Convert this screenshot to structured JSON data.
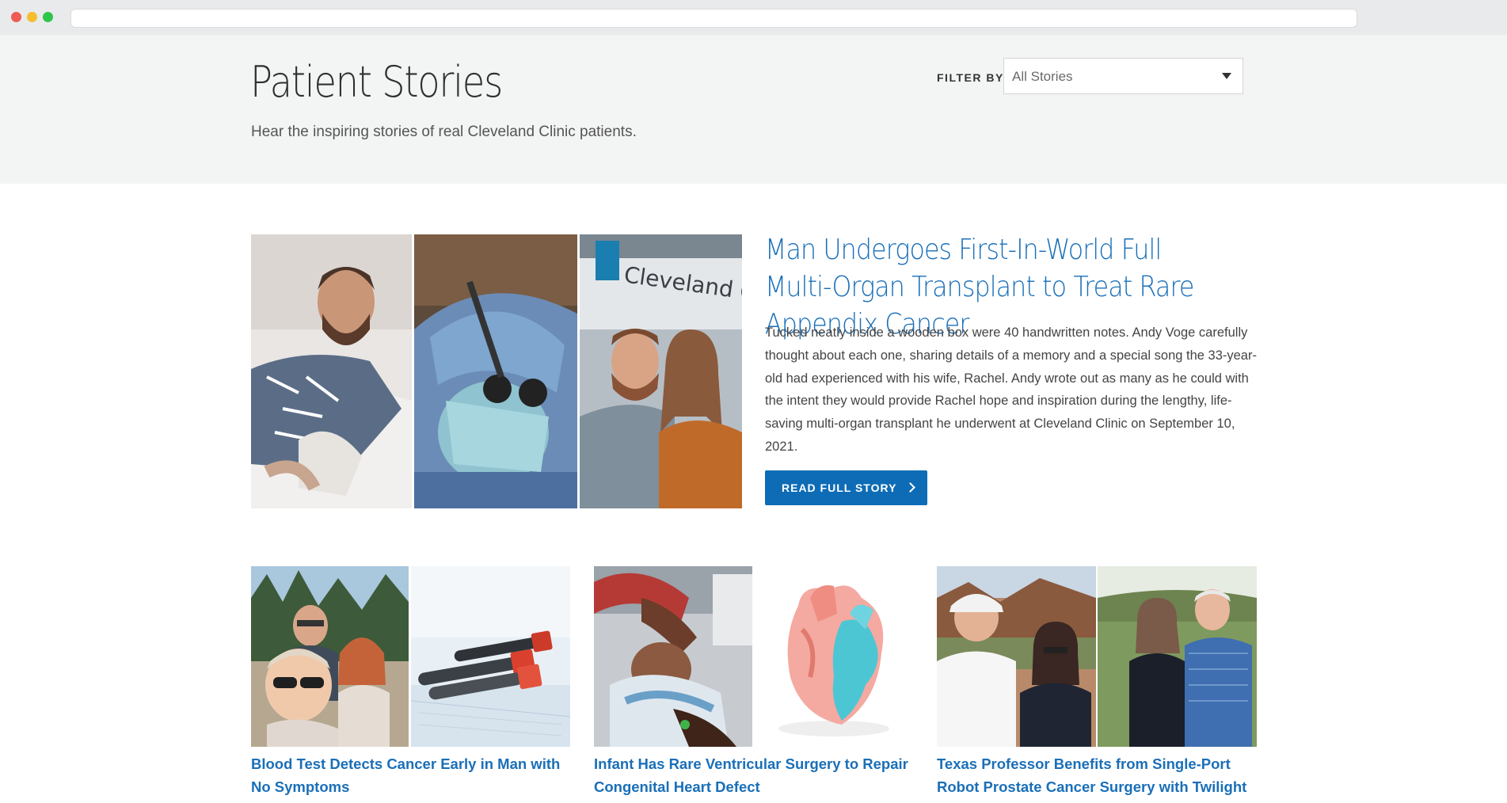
{
  "header": {
    "title": "Patient Stories",
    "subtitle": "Hear the inspiring stories of real Cleveland Clinic patients.",
    "filter_label": "FILTER BY:",
    "filter_value": "All Stories"
  },
  "featured": {
    "title": "Man Undergoes First-In-World Full Multi-Organ Transplant to Treat Rare Appendix Cancer",
    "body": "Tucked neatly inside a wooden box were 40 handwritten notes. Andy Voge carefully thought about each one, sharing details of a memory and a special song the 33-year-old had experienced with his wife, Rachel. Andy wrote out as many as he could with the intent they would provide Rachel hope and inspiration during the lengthy, life-saving multi-organ transplant he underwent at Cleveland Clinic on September 10, 2021.",
    "button_label": "READ FULL STORY",
    "sign_text": "Cleveland Clinic"
  },
  "cards": [
    {
      "title": "Blood Test Detects Cancer Early in Man with No Symptoms"
    },
    {
      "title": "Infant Has Rare Ventricular Surgery to Repair Congenital Heart Defect"
    },
    {
      "title": "Texas Professor Benefits from Single-Port Robot Prostate Cancer Surgery with Twilight Sedation"
    }
  ],
  "colors": {
    "link": "#1a6fb8",
    "button": "#0e6cb6",
    "hero_bg": "#f3f4f4"
  }
}
